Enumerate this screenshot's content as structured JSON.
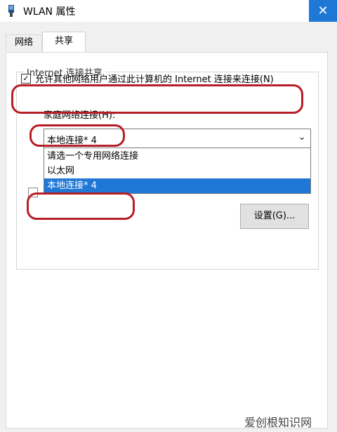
{
  "window": {
    "title": "WLAN 属性",
    "close_glyph": "✕"
  },
  "tabs": [
    {
      "label": "网络"
    },
    {
      "label": "共享"
    }
  ],
  "group": {
    "title": "Internet 连接共享",
    "allow_checkbox": {
      "checked": true,
      "label": "允许其他网络用户通过此计算机的 Internet 连接来连接(N)"
    },
    "home_label": "家庭网络连接(H):",
    "combo": {
      "value": "本地连接* 4",
      "options": [
        "请选一个专用网络连接",
        "以太网",
        "本地连接* 4"
      ],
      "selected": "本地连接* 4"
    },
    "settings_button": "设置(G)..."
  },
  "colors": {
    "accent": "#1f77d6",
    "highlight": "#b81e27"
  },
  "watermark": "爱创根知识网",
  "icons": {
    "window_icon": "network-adapter-icon",
    "combo_arrow": "chevron-down-icon",
    "check": "checkmark-icon"
  }
}
